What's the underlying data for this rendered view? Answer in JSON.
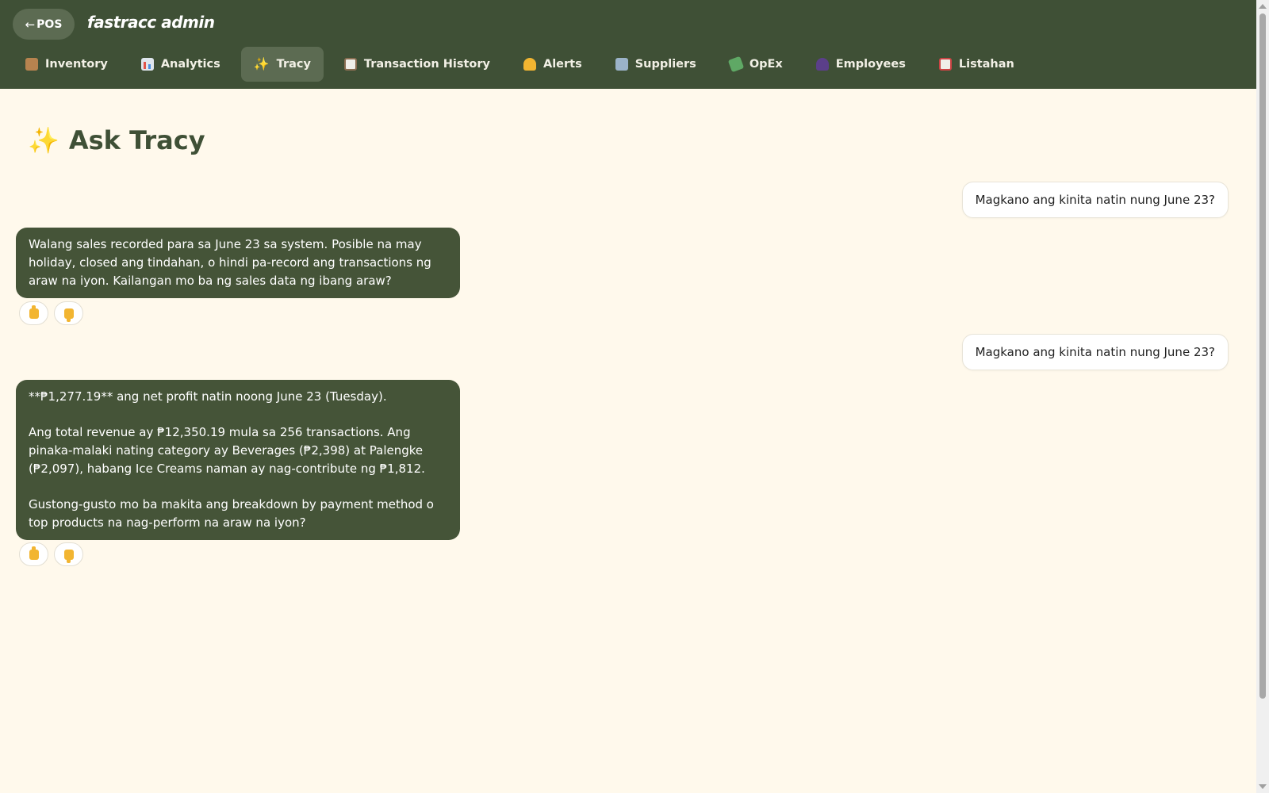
{
  "header": {
    "pos_button": {
      "arrow": "←",
      "label": "POS"
    },
    "brand": "fastracc admin",
    "tabs": [
      {
        "label": "Inventory",
        "icon": "package-icon",
        "active": false
      },
      {
        "label": "Analytics",
        "icon": "bar-chart-icon",
        "active": false
      },
      {
        "label": "Tracy",
        "icon": "sparkles-icon",
        "active": true
      },
      {
        "label": "Transaction History",
        "icon": "clipboard-icon",
        "active": false
      },
      {
        "label": "Alerts",
        "icon": "bell-icon",
        "active": false
      },
      {
        "label": "Suppliers",
        "icon": "building-icon",
        "active": false
      },
      {
        "label": "OpEx",
        "icon": "money-icon",
        "active": false
      },
      {
        "label": "Employees",
        "icon": "people-icon",
        "active": false
      },
      {
        "label": "Listahan",
        "icon": "memo-icon",
        "active": false
      }
    ]
  },
  "page": {
    "title_icon": "✨",
    "title": "Ask Tracy"
  },
  "chat": {
    "messages": [
      {
        "role": "user",
        "text": "Magkano ang kinita natin nung June 23?"
      },
      {
        "role": "assistant",
        "paragraphs": [
          "Walang sales recorded para sa June 23 sa system. Posible na may holiday, closed ang tindahan, o hindi pa-record ang transactions ng araw na iyon. Kailangan mo ba ng sales data ng ibang araw?"
        ]
      },
      {
        "role": "user",
        "text": "Magkano ang kinita natin nung June 23?"
      },
      {
        "role": "assistant",
        "paragraphs": [
          "**₱1,277.19** ang net profit natin noong June 23 (Tuesday).",
          "Ang total revenue ay ₱12,350.19 mula sa 256 transactions. Ang pinaka-malaki nating category ay Beverages (₱2,398) at Palengke (₱2,097), habang Ice Creams naman ay nag-contribute ng ₱1,812.",
          "Gustong-gusto mo ba makita ang breakdown by payment method o top products na nag-perform na araw na iyon?"
        ]
      }
    ]
  },
  "colors": {
    "header_bg": "#3f5036",
    "page_bg": "#fff9ec",
    "bot_bubble": "#455438",
    "title": "#3f5036"
  }
}
